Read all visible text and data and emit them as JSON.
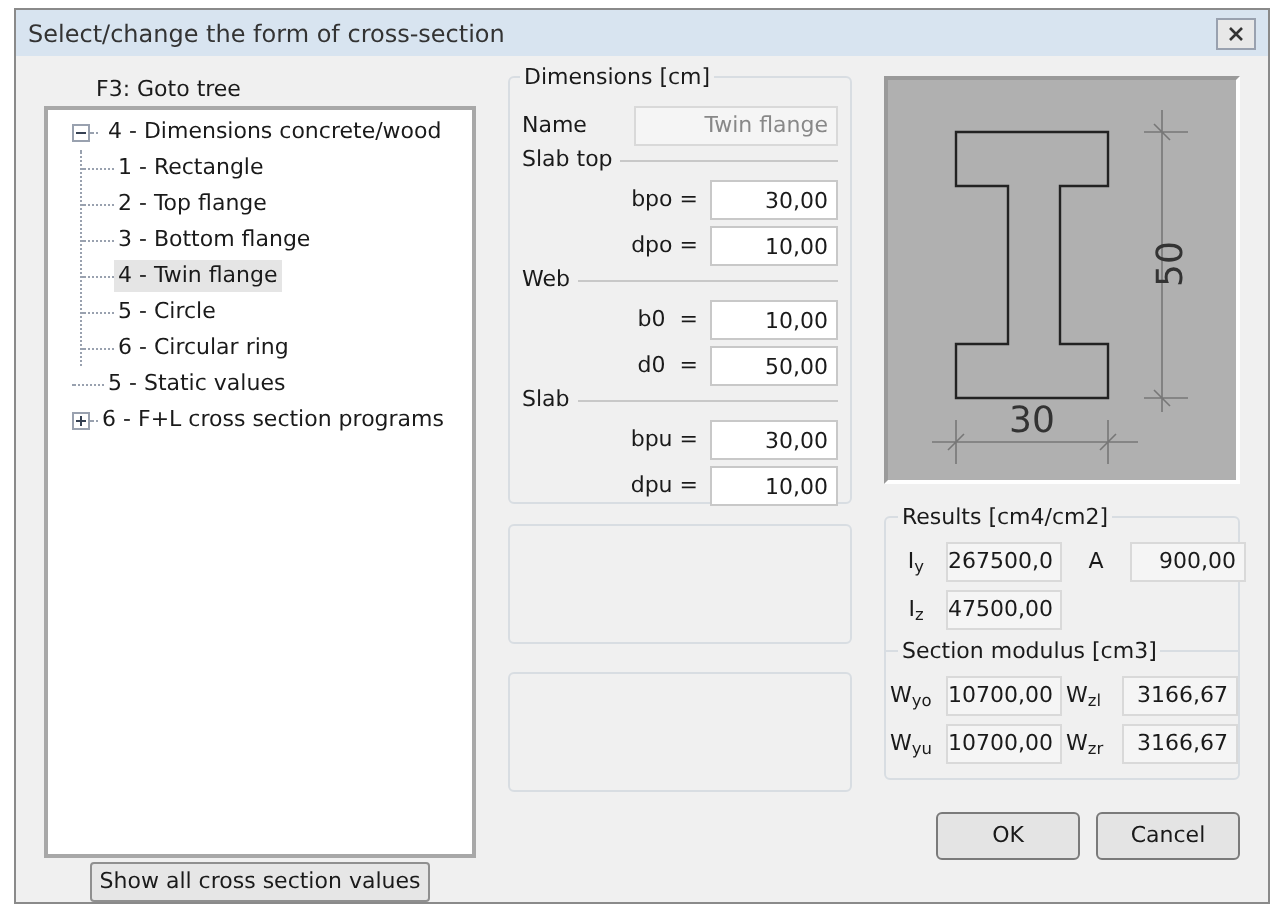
{
  "window": {
    "title": "Select/change the form of cross-section"
  },
  "tree": {
    "label": "F3: Goto tree",
    "items": [
      {
        "label": "4 - Dimensions concrete/wood",
        "expanded": true,
        "selected": false,
        "children": [
          {
            "label": "1 - Rectangle",
            "selected": false
          },
          {
            "label": "2 - Top flange",
            "selected": false
          },
          {
            "label": "3 - Bottom flange",
            "selected": false
          },
          {
            "label": "4 - Twin flange",
            "selected": true
          },
          {
            "label": "5 - Circle",
            "selected": false
          },
          {
            "label": "6 - Circular ring",
            "selected": false
          }
        ]
      },
      {
        "label": "5 - Static values",
        "selected": false
      },
      {
        "label": "6 - F+L cross section programs",
        "expanded": false,
        "selected": false
      }
    ]
  },
  "show_all_button": "Show all cross section values",
  "dimensions": {
    "title": "Dimensions [cm]",
    "name_label": "Name",
    "name_value": "Twin flange",
    "groups": [
      {
        "title": "Slab top",
        "fields": [
          {
            "label": "bpo =",
            "value": "30,00"
          },
          {
            "label": "dpo =",
            "value": "10,00"
          }
        ]
      },
      {
        "title": "Web",
        "fields": [
          {
            "label": "b0  =",
            "value": "10,00"
          },
          {
            "label": "d0  =",
            "value": "50,00"
          }
        ]
      },
      {
        "title": "Slab",
        "fields": [
          {
            "label": "bpu =",
            "value": "30,00"
          },
          {
            "label": "dpu =",
            "value": "10,00"
          }
        ]
      }
    ]
  },
  "preview": {
    "width_label": "30",
    "height_label": "50"
  },
  "results": {
    "title": "Results  [cm4/cm2]",
    "values": [
      {
        "label": "I$_{y}$",
        "value": "267500,0"
      },
      {
        "label": "A",
        "value": "900,00"
      },
      {
        "label": "I$_{z}$",
        "value": "47500,00"
      }
    ],
    "modulus_title": "Section modulus [cm3]",
    "modulus": [
      {
        "label": "W$_{yo}$",
        "value": "10700,00"
      },
      {
        "label": "W$_{zl}$",
        "value": "3166,67"
      },
      {
        "label": "W$_{yu}$",
        "value": "10700,00"
      },
      {
        "label": "W$_{zr}$",
        "value": "3166,67"
      }
    ]
  },
  "buttons": [
    "OK",
    "Cancel"
  ]
}
